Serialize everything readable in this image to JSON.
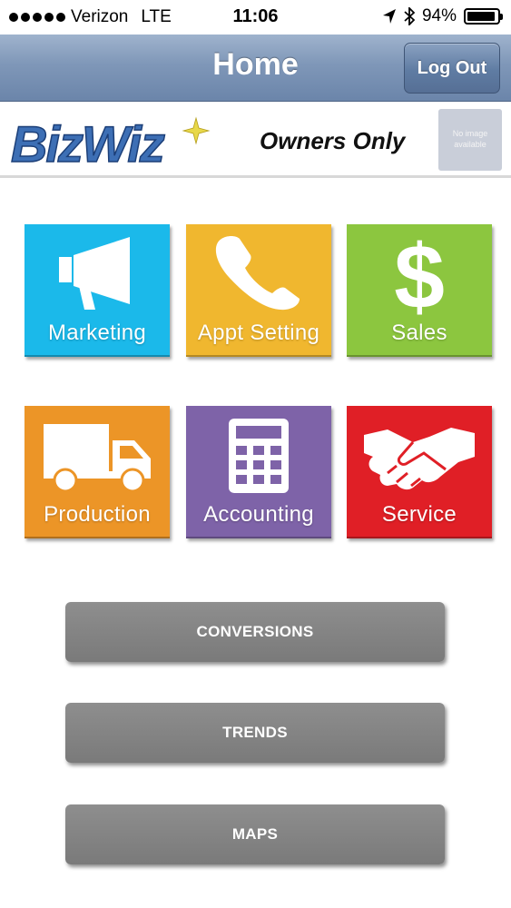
{
  "status_bar": {
    "carrier": "Verizon",
    "network": "LTE",
    "time": "11:06",
    "battery": "94%",
    "battery_level": 0.94
  },
  "nav": {
    "title": "Home",
    "logout_label": "Log Out"
  },
  "brand": {
    "logo_text": "BizWiz",
    "subtitle": "Owners Only",
    "no_image_text": "No image available"
  },
  "tiles": [
    {
      "label": "Marketing",
      "color": "#1bb9ea",
      "icon": "megaphone-icon"
    },
    {
      "label": "Appt Setting",
      "color": "#f0b72f",
      "icon": "phone-icon"
    },
    {
      "label": "Sales",
      "color": "#8cc63f",
      "icon": "dollar-icon"
    },
    {
      "label": "Production",
      "color": "#ec9527",
      "icon": "truck-icon"
    },
    {
      "label": "Accounting",
      "color": "#7e63a8",
      "icon": "calculator-icon"
    },
    {
      "label": "Service",
      "color": "#e01f26",
      "icon": "handshake-icon"
    }
  ],
  "buttons": {
    "conversions": "CONVERSIONS",
    "trends": "TRENDS",
    "maps": "MAPS"
  },
  "colors": {
    "nav_top": "#9fb3cd",
    "nav_bottom": "#6b85aa",
    "logo_blue": "#3d6fb5",
    "gray_button": "#7f7f7f"
  }
}
